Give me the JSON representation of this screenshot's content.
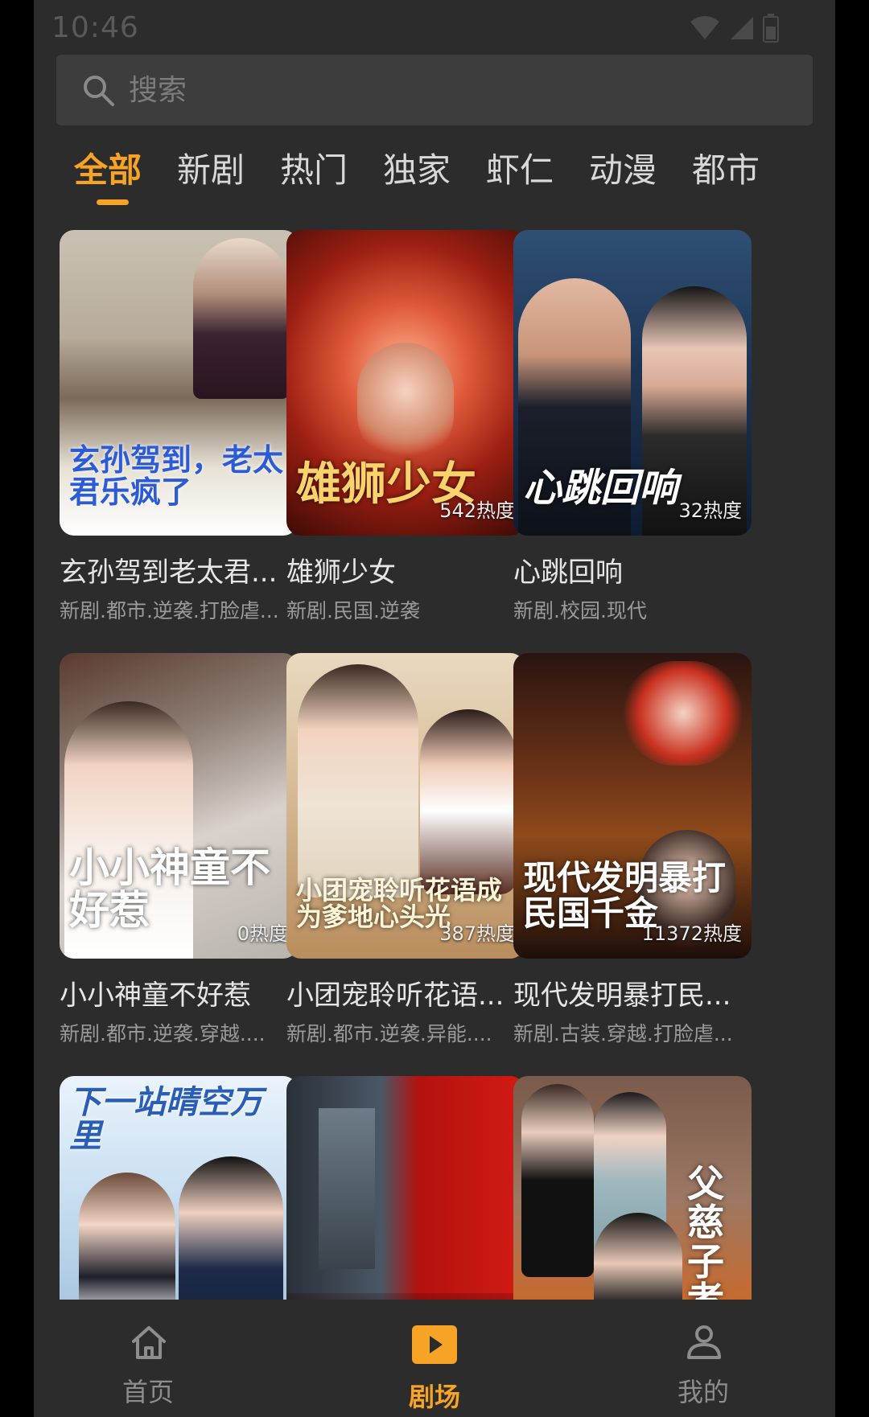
{
  "status": {
    "time": "10:46"
  },
  "search": {
    "placeholder": "搜索"
  },
  "tabs": [
    "全部",
    "新剧",
    "热门",
    "独家",
    "虾仁",
    "动漫",
    "都市"
  ],
  "active_tab": "全部",
  "dramas": [
    {
      "title": "玄孙驾到老太君...",
      "tags": "新剧.都市.逆袭.打脸虐...",
      "poster_text": "玄孙驾到，老太君乐疯了",
      "heat": ""
    },
    {
      "title": "雄狮少女",
      "tags": "新剧.民国.逆袭",
      "poster_text": "雄狮少女",
      "heat": "542热度"
    },
    {
      "title": "心跳回响",
      "tags": "新剧.校园.现代",
      "poster_text": "心跳回响",
      "heat": "32热度"
    },
    {
      "title": "小小神童不好惹",
      "tags": "新剧.都市.逆袭.穿越....",
      "poster_text": "小小神童不好惹",
      "heat": "0热度"
    },
    {
      "title": "小团宠聆听花语...",
      "tags": "新剧.都市.逆袭.异能....",
      "poster_text": "小团宠聆听花语成为爹地心头光",
      "heat": "387热度"
    },
    {
      "title": "现代发明暴打民...",
      "tags": "新剧.古装.穿越.打脸虐...",
      "poster_text": "现代发明暴打民国千金",
      "heat": "11372热度"
    },
    {
      "title": "",
      "tags": "",
      "poster_text": "下一站晴空万里",
      "heat": ""
    },
    {
      "title": "",
      "tags": "",
      "poster_text": "",
      "heat": ""
    },
    {
      "title": "",
      "tags": "",
      "poster_text": "父慈子孝",
      "heat": ""
    }
  ],
  "bottom_nav": [
    {
      "label": "首页",
      "icon": "home-icon"
    },
    {
      "label": "剧场",
      "icon": "play-icon"
    },
    {
      "label": "我的",
      "icon": "profile-icon"
    }
  ],
  "colors": {
    "accent": "#f7a325",
    "background": "#2c2c2c",
    "search_bg": "#3d3d3d"
  }
}
